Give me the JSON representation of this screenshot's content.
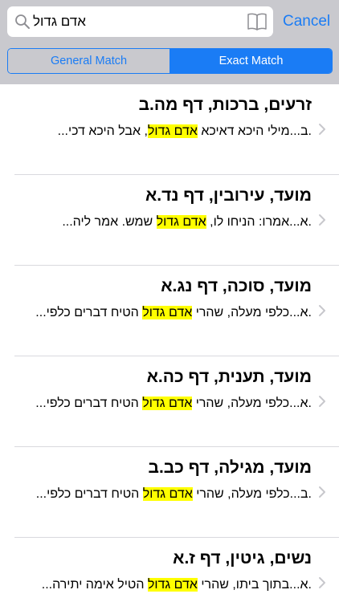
{
  "search": {
    "query": "אדם גדול",
    "cancel_label": "Cancel"
  },
  "segments": {
    "general": "General Match",
    "exact": "Exact Match",
    "selected": "exact"
  },
  "colors": {
    "accent": "#1a7cf5",
    "highlight": "#ffff00",
    "header_bg": "#c9c9ce"
  },
  "icons": {
    "search": "magnifier-icon",
    "bookmarks": "book-icon",
    "disclosure": "chevron-right-icon"
  },
  "results": [
    {
      "title": "זרעים, ברכות, דף מה.ב",
      "before": ".ב...מילי היכא דאיכא ",
      "match": "אדם גדול",
      "after": ", אבל היכא דכי..."
    },
    {
      "title": "מועד, עירובין, דף נד.א",
      "before": ".א...אמרו: הניחו לו, ",
      "match": "אדם גדול",
      "after": " שמש. אמר ליה..."
    },
    {
      "title": "מועד, סוכה, דף נג.א",
      "before": ".א...כלפי מעלה, שהרי ",
      "match": "אדם גדול",
      "after": " הטיח דברים כלפי..."
    },
    {
      "title": "מועד, תענית, דף כה.א",
      "before": ".א...כלפי מעלה, שהרי ",
      "match": "אדם גדול",
      "after": " הטיח דברים כלפי..."
    },
    {
      "title": "מועד, מגילה, דף כב.ב",
      "before": ".ב...כלפי מעלה, שהרי ",
      "match": "אדם גדול",
      "after": " הטיח דברים כלפי..."
    },
    {
      "title": "נשים, גיטין, דף ז.א",
      "before": ".א...בתוך ביתו, שהרי ",
      "match": "אדם גדול",
      "after": " הטיל אימה יתירה..."
    }
  ]
}
